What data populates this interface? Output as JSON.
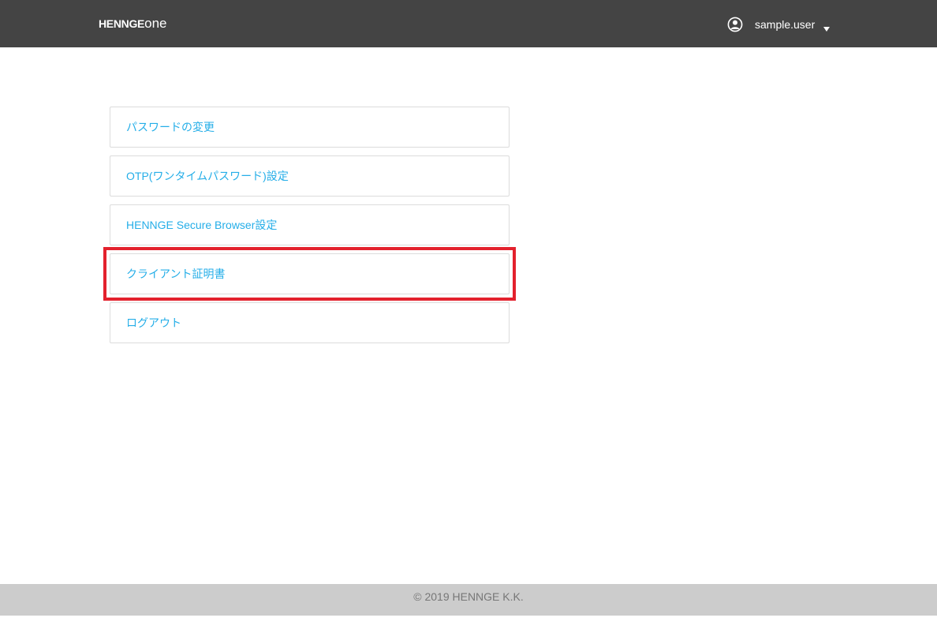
{
  "header": {
    "logo": {
      "part1": "HENNGE",
      "part2": "one"
    },
    "user": {
      "name": "sample.user",
      "icon": "user-circle-icon",
      "caret_icon": "caret-down-icon"
    }
  },
  "menu": {
    "items": [
      {
        "label": "パスワードの変更"
      },
      {
        "label": "OTP(ワンタイムパスワード)設定"
      },
      {
        "label": "HENNGE Secure Browser設定"
      },
      {
        "label": "クライアント証明書"
      },
      {
        "label": "ログアウト"
      }
    ],
    "highlighted_index": 3
  },
  "footer": {
    "copyright": "© 2019 HENNGE K.K."
  },
  "colors": {
    "header_bg": "#444444",
    "link": "#25aee8",
    "highlight": "#e3212d",
    "footer_bg": "#cccccc",
    "footer_text": "#777777"
  }
}
